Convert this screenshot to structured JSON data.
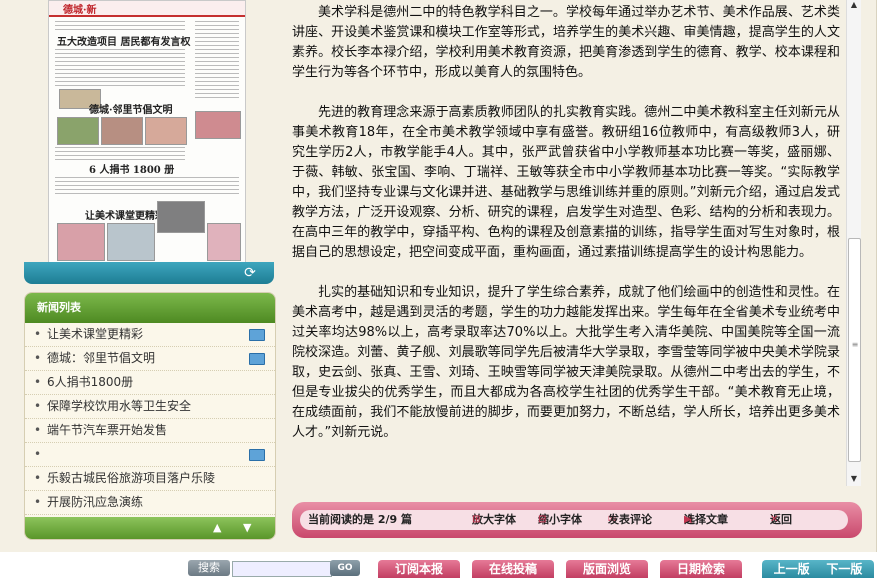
{
  "thumbnail": {
    "masthead": "德城·新",
    "headline_1": "五大改造项目 居民都有发言权",
    "headline_2": "德城·邻里节倡文明",
    "headline_3": "6 人捐书 1800 册",
    "headline_4": "让美术课堂更精彩"
  },
  "news_list": {
    "title": "新闻列表",
    "items": [
      {
        "label": "让美术课堂更精彩",
        "icon": "tv-icon"
      },
      {
        "label": "德城：邻里节倡文明",
        "icon": "tv-icon"
      },
      {
        "label": "6人捐书1800册",
        "icon": ""
      },
      {
        "label": "保障学校饮用水等卫生安全",
        "icon": ""
      },
      {
        "label": "端午节汽车票开始发售",
        "icon": ""
      },
      {
        "label": "",
        "icon": "tv-icon"
      },
      {
        "label": "乐毅古城民俗旅游项目落户乐陵",
        "icon": ""
      },
      {
        "label": "开展防汛应急演练",
        "icon": ""
      }
    ]
  },
  "article": {
    "paragraphs": [
      "美术学科是德州二中的特色教学科目之一。学校每年通过举办艺术节、美术作品展、艺术类讲座、开设美术鉴赏课和模块工作室等形式，培养学生的美术兴趣、审美情趣，提高学生的人文素养。校长李本禄介绍，学校利用美术教育资源，把美育渗透到学生的德育、教学、校本课程和学生行为等各个环节中，形成以美育人的氛围特色。",
      "先进的教育理念来源于高素质教师团队的扎实教育实践。德州二中美术教科室主任刘新元从事美术教育18年，在全市美术教学领域中享有盛誉。教研组16位教师中，有高级教师3人，研究生学历2人，市教学能手4人。其中，张严武曾获省中小学教师基本功比赛一等奖，盛丽娜、于薇、韩敏、张宝国、李响、丁瑞祥、王敏等获全市中小学教师基本功比赛一等奖。“实际教学中，我们坚持专业课与文化课并进、基础教学与思维训练并重的原则。”刘新元介绍，通过启发式教学方法，广泛开设观察、分析、研究的课程，启发学生对造型、色彩、结构的分析和表现力。在高中三年的教学中，穿插平构、色构的课程及创意素描的训练，指导学生面对写生对象时，根据自己的思想设定，把空间变成平面，重构画面，通过素描训练提高学生的设计构思能力。",
      "扎实的基础知识和专业知识，提升了学生综合素养，成就了他们绘画中的创造性和灵性。在美术高考中，越是遇到灵活的考题，学生的功力越能发挥出来。学生每年在全省美术专业统考中过关率均达98%以上，高考录取率达70%以上。大批学生考入清华美院、中国美院等全国一流院校深造。刘蕾、黄子舰、刘晨歌等同学先后被清华大学录取，李雪莹等同学被中央美术学院录取，史云剑、张真、王雪、刘琦、王映雪等同学被天津美院录取。从德州二中考出去的学生，不但是专业拔尖的优秀学生，而且大都成为各高校学生社团的优秀学生干部。“美术教育无止境，在成绩面前，我们不能放慢前进的脚步，而要更加努力，不断总结，学人所长，培养出更多美术人才。”刘新元说。"
    ]
  },
  "read_bar": {
    "progress": "当前阅读的是 2/9 篇",
    "enlarge": "放大字体",
    "shrink": "缩小字体",
    "comment": "发表评论",
    "select": "选择文章",
    "back": "返回"
  },
  "bottom_bar": {
    "search_label": "搜索",
    "go": "GO",
    "subscribe": "订阅本报",
    "submit": "在线投稿",
    "layout_browse": "版面浏览",
    "date_search": "日期检索",
    "prev_next": "上一版    下一版"
  }
}
